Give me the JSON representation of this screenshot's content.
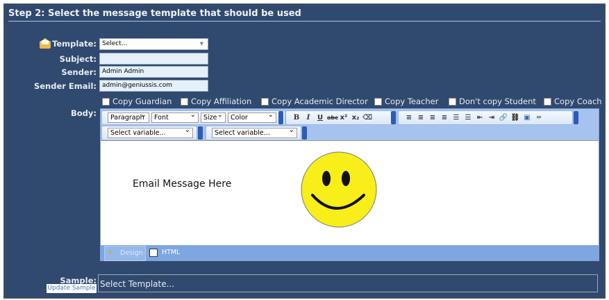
{
  "step_title": "Step 2: Select the message template that should be used",
  "form": {
    "template_label": "Template:",
    "template_value": "Select...",
    "subject_label": "Subject:",
    "subject_value": "",
    "sender_label": "Sender:",
    "sender_value": "Admin Admin",
    "email_label": "Sender Email:",
    "email_value": "admin@geniussis.com",
    "body_label": "Body:"
  },
  "checkboxes": [
    {
      "label": "Copy Guardian",
      "checked": false
    },
    {
      "label": "Copy Affiliation",
      "checked": false
    },
    {
      "label": "Copy Academic Director",
      "checked": false
    },
    {
      "label": "Copy Teacher",
      "checked": false
    },
    {
      "label": "Don't copy Student",
      "checked": false
    },
    {
      "label": "Copy Coach",
      "checked": false
    }
  ],
  "toolbar": {
    "paragraph": "Paragraph",
    "font": "Font",
    "size": "Size",
    "color": "Color",
    "variable1": "Select variable...",
    "variable2": "Select variable..."
  },
  "editor": {
    "content_text": "Email Message Here",
    "tab_design": "Design",
    "tab_html": "HTML"
  },
  "sample": {
    "label": "Sample:",
    "update_button": "Update Sample",
    "value": "Select Template..."
  },
  "colors": {
    "panel": "#30496f",
    "editor_toolbar": "#a6c3ef",
    "smiley": "#f7ee1a"
  }
}
